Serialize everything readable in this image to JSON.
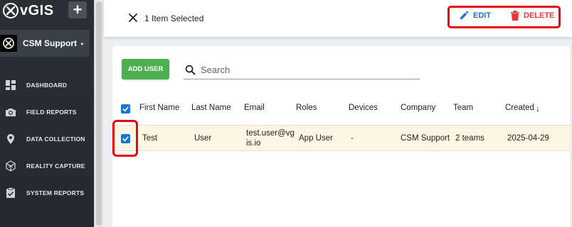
{
  "sidebar": {
    "logo_text": "vGIS",
    "plus_label": "+",
    "org_name": "CSM Support",
    "org_arrow": "▸",
    "items": [
      {
        "label": "DASHBOARD",
        "icon": "dashboard-icon"
      },
      {
        "label": "FIELD REPORTS",
        "icon": "camera-icon"
      },
      {
        "label": "DATA COLLECTION",
        "icon": "location-pin-icon"
      },
      {
        "label": "REALITY CAPTURE",
        "icon": "cube-icon"
      },
      {
        "label": "SYSTEM REPORTS",
        "icon": "clipboard-check-icon"
      }
    ]
  },
  "topbar": {
    "selection_text": "1 Item Selected",
    "edit_label": "EDIT",
    "delete_label": "DELETE"
  },
  "toolbar": {
    "add_user_label": "ADD USER",
    "search_placeholder": "Search"
  },
  "table": {
    "headers": [
      "First Name",
      "Last Name",
      "Email",
      "Roles",
      "Devices",
      "Company",
      "Team",
      "Created"
    ],
    "sort_indicator": "↓",
    "rows": [
      {
        "first_name": "Test",
        "last_name": "User",
        "email_line1": "test.user@vg",
        "email_line2": "is.io",
        "roles": "App User",
        "devices": "-",
        "company": "CSM Support",
        "team": "2 teams",
        "created": "2025-04-29",
        "selected": true
      }
    ]
  },
  "colors": {
    "primary": "#1976d2",
    "danger": "#e53935",
    "success": "#4caf50",
    "sidebar_bg": "#2a2f36",
    "highlight_row": "#fdf6e3",
    "annotation_red": "#e30613"
  }
}
